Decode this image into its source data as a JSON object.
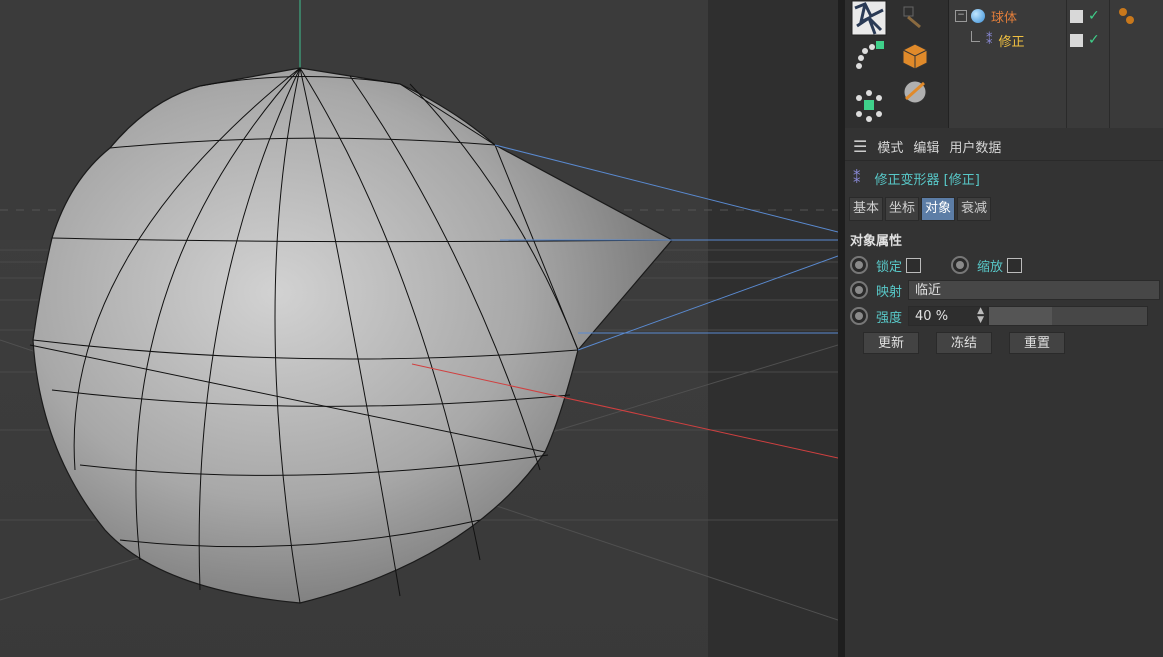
{
  "objects": [
    {
      "name": "球体",
      "color": "#e07d3a"
    },
    {
      "name": "修正",
      "color": "#f0c040"
    }
  ],
  "attribute_manager": {
    "menu": [
      "模式",
      "编辑",
      "用户数据"
    ],
    "title": "修正变形器 [修正]",
    "tabs": [
      "基本",
      "坐标",
      "对象",
      "衰减"
    ],
    "active_tab": "对象",
    "section": "对象属性",
    "lock_label": "锁定",
    "scale_label": "缩放",
    "mapping_label": "映射",
    "mapping_value": "临近",
    "strength_label": "强度",
    "strength_value": "40 %",
    "strength_fraction": 0.4,
    "buttons": [
      "更新",
      "冻结",
      "重置"
    ]
  },
  "colors": {
    "label_cyan": "#58c8c8",
    "active_tab": "#5c7da6",
    "sphere_object": "#e07d3a",
    "correction_object": "#f0c040"
  },
  "icons": [
    "move-tool-icon",
    "spline-icon",
    "cube-icon",
    "deformer-icon",
    "array-icon",
    "sphere-icon",
    "checkmark-icon"
  ]
}
